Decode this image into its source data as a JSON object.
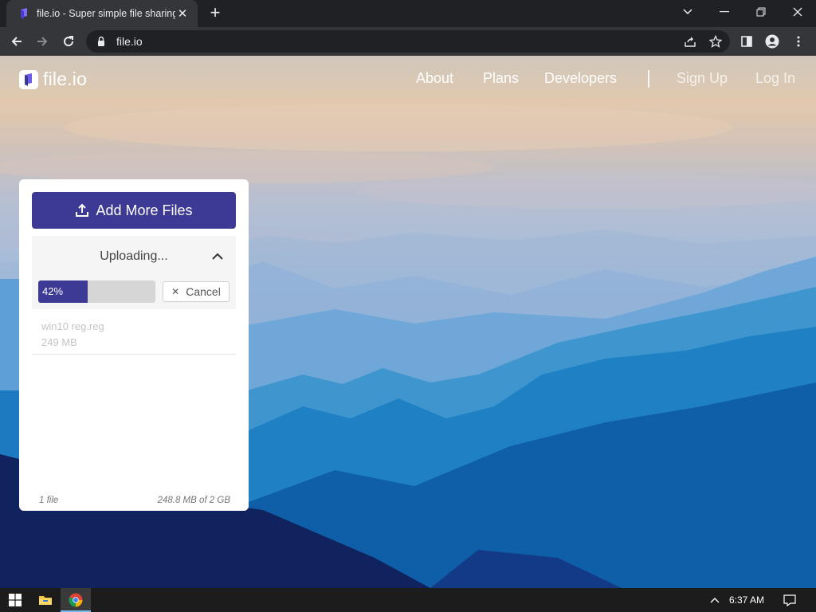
{
  "browser": {
    "tab_title": "file.io - Super simple file sharing",
    "url": "file.io"
  },
  "site": {
    "logo_text": "file.io",
    "nav": [
      {
        "label": "About"
      },
      {
        "label": "Plans"
      },
      {
        "label": "Developers"
      },
      {
        "label": "Sign Up"
      },
      {
        "label": "Log In"
      }
    ]
  },
  "upload": {
    "add_button_label": "Add More Files",
    "status_title": "Uploading...",
    "progress": 0.42,
    "progress_label": "42%",
    "cancel_label": "Cancel",
    "files": [
      {
        "name": "win10 reg.reg",
        "size": "249 MB"
      }
    ],
    "footer_count": "1 file",
    "footer_usage": "248.8 MB of 2 GB"
  },
  "taskbar": {
    "time": "6:37 AM"
  },
  "colors": {
    "brand_purple": "#3d3a96",
    "chrome_dark": "#202124",
    "chrome_toolbar": "#35363a"
  },
  "icons": [
    "windows-start-icon",
    "file-explorer-icon",
    "chrome-icon",
    "upload-icon",
    "chevron-up-icon",
    "lock-icon",
    "star-icon",
    "share-icon",
    "profile-icon",
    "menu-icon",
    "notification-icon"
  ]
}
